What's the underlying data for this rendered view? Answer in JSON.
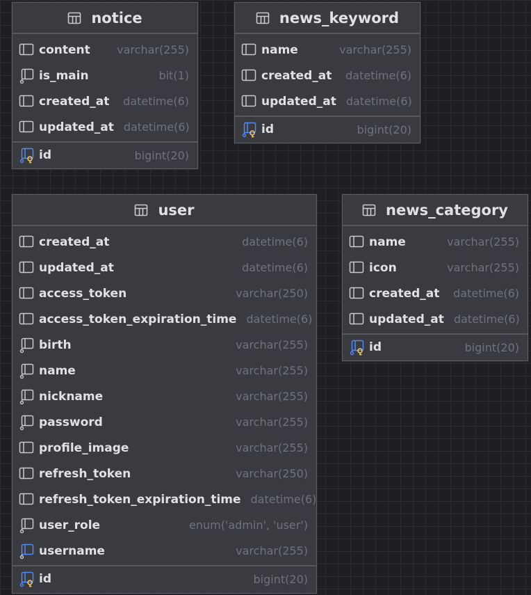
{
  "tables": [
    {
      "id": "notice",
      "name": "notice",
      "columns": [
        {
          "name": "content",
          "type": "varchar(255)",
          "icon": "column-icon"
        },
        {
          "name": "is_main",
          "type": "bit(1)",
          "icon": "column-notnull-icon"
        },
        {
          "name": "created_at",
          "type": "datetime(6)",
          "icon": "column-icon"
        },
        {
          "name": "updated_at",
          "type": "datetime(6)",
          "icon": "column-icon"
        }
      ],
      "primary_key": {
        "name": "id",
        "type": "bigint(20)",
        "icon": "primary-key-icon"
      }
    },
    {
      "id": "news_keyword",
      "name": "news_keyword",
      "columns": [
        {
          "name": "name",
          "type": "varchar(255)",
          "icon": "column-icon"
        },
        {
          "name": "created_at",
          "type": "datetime(6)",
          "icon": "column-icon"
        },
        {
          "name": "updated_at",
          "type": "datetime(6)",
          "icon": "column-icon"
        }
      ],
      "primary_key": {
        "name": "id",
        "type": "bigint(20)",
        "icon": "primary-key-icon"
      }
    },
    {
      "id": "user",
      "name": "user",
      "columns": [
        {
          "name": "created_at",
          "type": "datetime(6)",
          "icon": "column-icon"
        },
        {
          "name": "updated_at",
          "type": "datetime(6)",
          "icon": "column-icon"
        },
        {
          "name": "access_token",
          "type": "varchar(250)",
          "icon": "column-icon"
        },
        {
          "name": "access_token_expiration_time",
          "type": "datetime(6)",
          "icon": "column-icon"
        },
        {
          "name": "birth",
          "type": "varchar(255)",
          "icon": "column-notnull-icon"
        },
        {
          "name": "name",
          "type": "varchar(255)",
          "icon": "column-notnull-icon"
        },
        {
          "name": "nickname",
          "type": "varchar(255)",
          "icon": "column-notnull-icon"
        },
        {
          "name": "password",
          "type": "varchar(255)",
          "icon": "column-notnull-icon"
        },
        {
          "name": "profile_image",
          "type": "varchar(255)",
          "icon": "column-icon"
        },
        {
          "name": "refresh_token",
          "type": "varchar(250)",
          "icon": "column-icon"
        },
        {
          "name": "refresh_token_expiration_time",
          "type": "datetime(6)",
          "icon": "column-icon"
        },
        {
          "name": "user_role",
          "type": "enum('admin', 'user')",
          "icon": "column-notnull-icon"
        },
        {
          "name": "username",
          "type": "varchar(255)",
          "icon": "column-index-icon"
        }
      ],
      "primary_key": {
        "name": "id",
        "type": "bigint(20)",
        "icon": "primary-key-icon"
      }
    },
    {
      "id": "news_category",
      "name": "news_category",
      "columns": [
        {
          "name": "name",
          "type": "varchar(255)",
          "icon": "column-icon"
        },
        {
          "name": "icon",
          "type": "varchar(255)",
          "icon": "column-icon"
        },
        {
          "name": "created_at",
          "type": "datetime(6)",
          "icon": "column-icon"
        },
        {
          "name": "updated_at",
          "type": "datetime(6)",
          "icon": "column-icon"
        }
      ],
      "primary_key": {
        "name": "id",
        "type": "bigint(20)",
        "icon": "primary-key-icon"
      }
    }
  ],
  "colors": {
    "canvas": "#1e1f22",
    "table_bg": "#393b40",
    "text": "#dfe1e5",
    "type_text": "#6f737a",
    "icon_gray": "#c9cbcf",
    "index_blue": "#548af7",
    "key_gold": "#f2c55c"
  }
}
